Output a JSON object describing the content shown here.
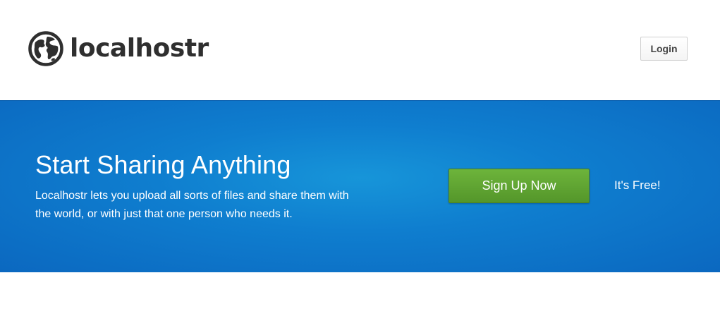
{
  "header": {
    "brand": "localhostr",
    "login_label": "Login"
  },
  "hero": {
    "title": "Start Sharing Anything",
    "description": "Localhostr lets you upload all sorts of files and share them with the world, or with just that one person who needs it.",
    "signup_label": "Sign Up Now",
    "free_label": "It's Free!"
  },
  "colors": {
    "hero_blue": "#0f7ecf",
    "signup_green": "#5fa532",
    "logo_dark": "#2f2f2f"
  },
  "icons": {
    "logo": "globe-icon"
  }
}
